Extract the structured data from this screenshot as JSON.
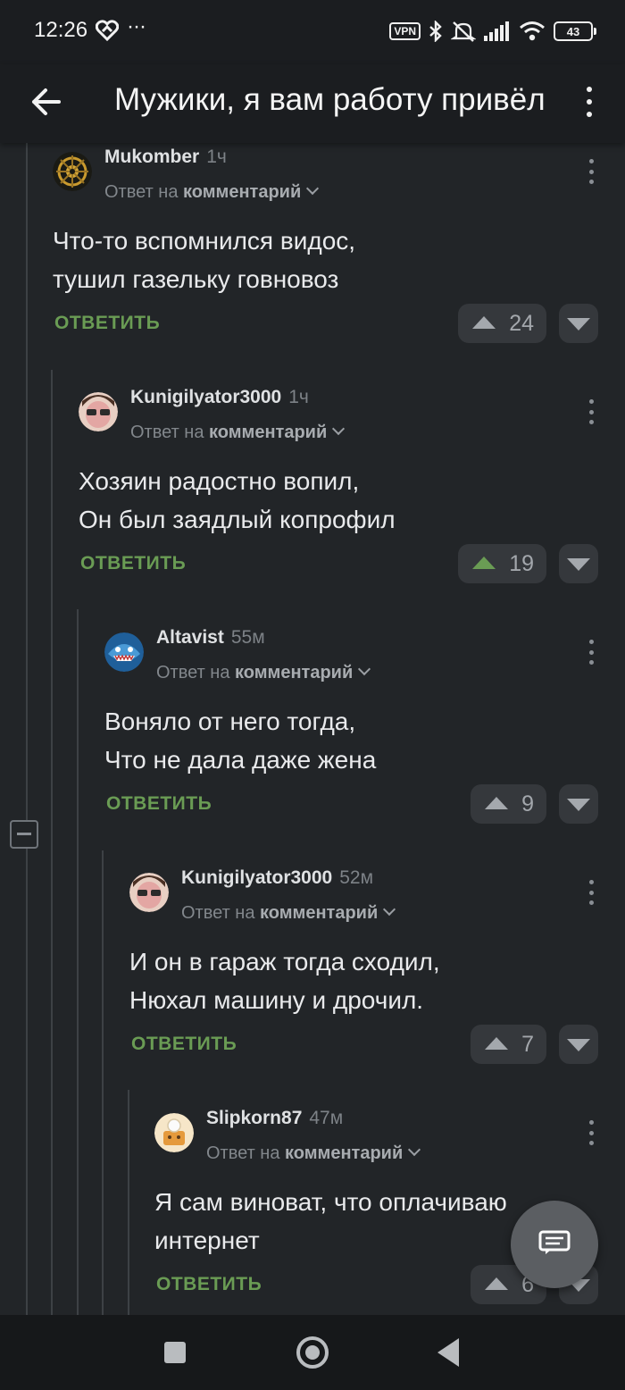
{
  "status_bar": {
    "time": "12:26",
    "dots": "···",
    "vpn": "VPN",
    "battery": "43"
  },
  "app_bar": {
    "title": "Мужики, я вам работу привёл"
  },
  "comments": [
    {
      "author": "Mukomber",
      "time": "1ч",
      "reply_prefix": "Ответ на",
      "reply_target": "комментарий",
      "lines": [
        "Что-то вспомнился видос,",
        "тушил газельку говновоз"
      ],
      "reply_label": "ОТВЕТИТЬ",
      "votes": "24",
      "voted": false
    },
    {
      "author": "Kunigilyator3000",
      "time": "1ч",
      "reply_prefix": "Ответ на",
      "reply_target": "комментарий",
      "lines": [
        "Хозяин радостно вопил,",
        "Он был заядлый копрофил"
      ],
      "reply_label": "ОТВЕТИТЬ",
      "votes": "19",
      "voted": true
    },
    {
      "author": "Altavist",
      "time": "55м",
      "reply_prefix": "Ответ на",
      "reply_target": "комментарий",
      "lines": [
        "Воняло от него тогда,",
        "Что не дала даже жена"
      ],
      "reply_label": "ОТВЕТИТЬ",
      "votes": "9",
      "voted": false
    },
    {
      "author": "Kunigilyator3000",
      "time": "52м",
      "reply_prefix": "Ответ на",
      "reply_target": "комментарий",
      "lines": [
        "И он в гараж тогда сходил,",
        "Нюхал машину и дрочил."
      ],
      "reply_label": "ОТВЕТИТЬ",
      "votes": "7",
      "voted": false
    },
    {
      "author": "Slipkorn87",
      "time": "47м",
      "reply_prefix": "Ответ на",
      "reply_target": "комментарий",
      "lines": [
        "Я сам виноват, что оплачиваю",
        "интернет"
      ],
      "reply_label": "ОТВЕТИТЬ",
      "votes": "6",
      "voted": false
    }
  ],
  "colors": {
    "background": "#222528",
    "bars": "#1b1d20",
    "reply_green": "#6a9c54",
    "vote_pill": "#35383c"
  },
  "icons": {
    "back": "arrow-left-icon",
    "menu": "more-vertical-icon",
    "fab": "comment-icon"
  }
}
